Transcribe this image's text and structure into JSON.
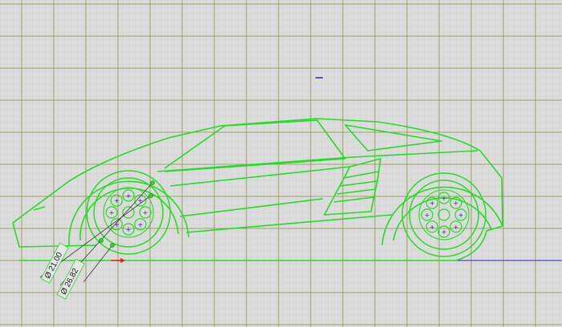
{
  "viewport": {
    "background_color": "#dcdcdc",
    "grid_major_color": "#8a8a3a",
    "grid_minor_color": "#c4c4c4"
  },
  "sketch": {
    "entity_color": "#22dd22",
    "axis_x_color": "#2020c8",
    "origin_color": "#e02020",
    "subject": "sports car side profile sketch"
  },
  "dimensions": [
    {
      "symbol": "Ø",
      "value": "21.00",
      "label": "Ø 21.00"
    },
    {
      "symbol": "Ø",
      "value": "26.82",
      "label": "Ø 26.82"
    }
  ]
}
